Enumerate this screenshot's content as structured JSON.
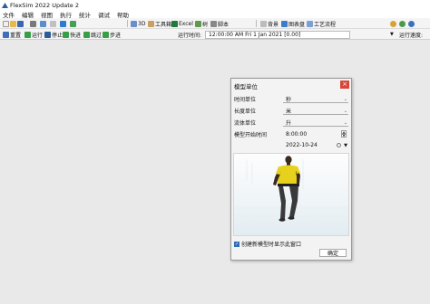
{
  "window": {
    "title": "FlexSim 2022 Update 2"
  },
  "menu": [
    "文件",
    "编辑",
    "视图",
    "执行",
    "统计",
    "调试",
    "帮助"
  ],
  "toolbar": {
    "view_3d": "3D",
    "toolbox": "工具箱",
    "excel": "Excel",
    "tree": "树",
    "script": "脚本",
    "background": "背景",
    "chart_dashboard": "图表盘",
    "process_flow": "工艺流程"
  },
  "run_bar": {
    "reset": "重置",
    "run": "运行",
    "stop": "停止",
    "fast_forward": "快进",
    "skip": "跳过",
    "step": "步进",
    "run_time_label": "运行时间:",
    "run_time_value": "12:00:00 AM  Fri 1 Jan 2021  [0.00]",
    "speed_label": "运行速度:"
  },
  "dialog": {
    "title": "模型单位",
    "close": "×",
    "fields": [
      {
        "label": "时间单位",
        "value": "秒"
      },
      {
        "label": "长度单位",
        "value": "米"
      },
      {
        "label": "流体单位",
        "value": "升"
      }
    ],
    "start_time_label": "模型开始时间",
    "start_time_value": "8:00:00",
    "start_date_value": "2022-10-24",
    "checkbox_label": "创建新模型时显示此窗口",
    "checkbox_checked": true,
    "ok_label": "确定"
  },
  "colors": {
    "accent": "#2f6db5",
    "close": "#d8463a",
    "shirt": "#e6d21c",
    "pants": "#3a3a3a"
  }
}
